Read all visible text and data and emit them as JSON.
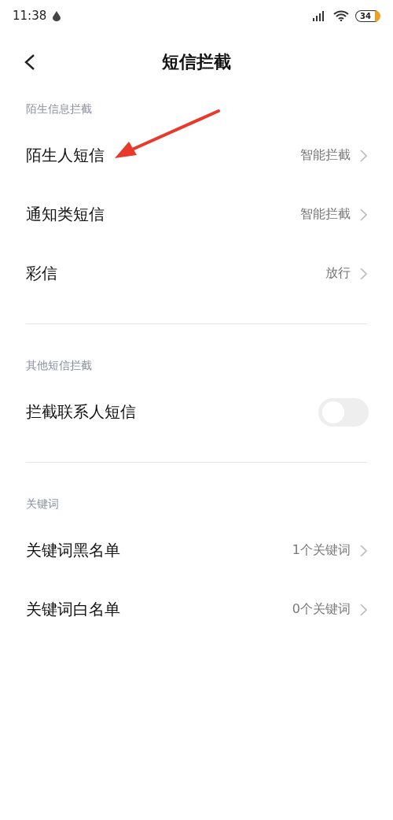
{
  "status_bar": {
    "time": "11:38",
    "battery": "34"
  },
  "header": {
    "title": "短信拦截"
  },
  "sections": [
    {
      "label": "陌生信息拦截",
      "rows": [
        {
          "kind": "link",
          "title": "陌生人短信",
          "value": "智能拦截"
        },
        {
          "kind": "link",
          "title": "通知类短信",
          "value": "智能拦截"
        },
        {
          "kind": "link",
          "title": "彩信",
          "value": "放行"
        }
      ]
    },
    {
      "label": "其他短信拦截",
      "rows": [
        {
          "kind": "toggle",
          "title": "拦截联系人短信",
          "on": false
        }
      ]
    },
    {
      "label": "关键词",
      "rows": [
        {
          "kind": "link",
          "title": "关键词黑名单",
          "value": "1个关键词"
        },
        {
          "kind": "link",
          "title": "关键词白名单",
          "value": "0个关键词"
        }
      ]
    }
  ]
}
